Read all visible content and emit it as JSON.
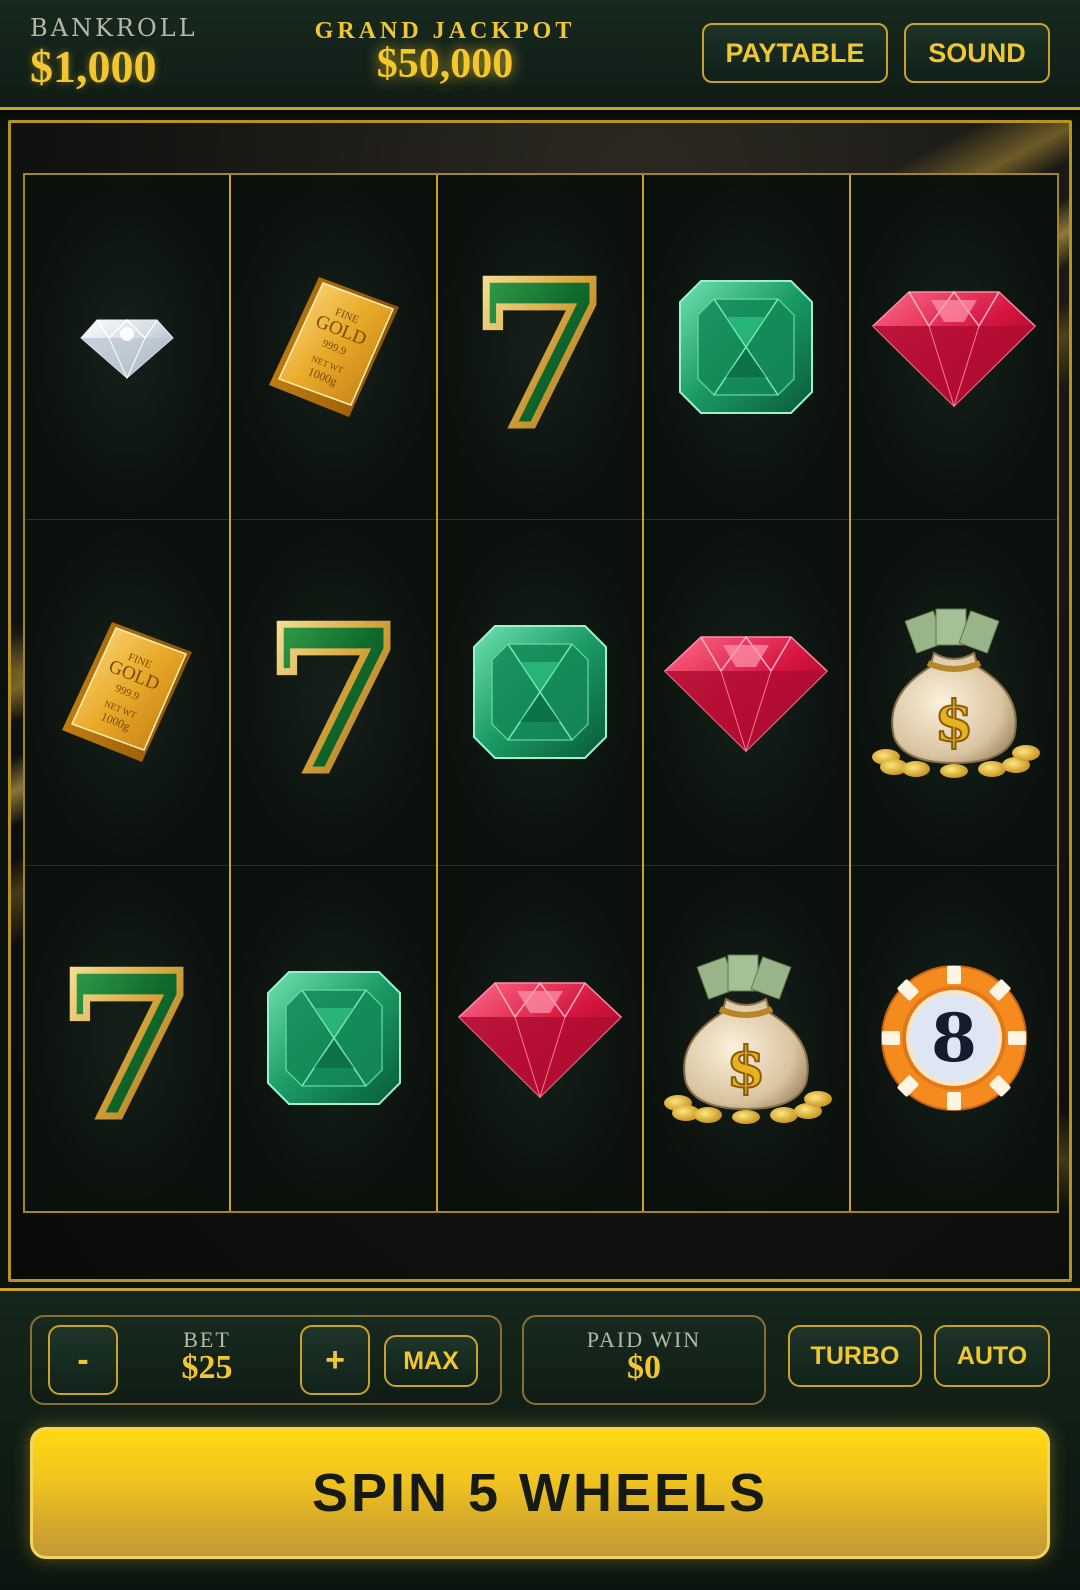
{
  "header": {
    "bankroll_label": "BANKROLL",
    "bankroll_value": "$1,000",
    "jackpot_label": "GRAND JACKPOT",
    "jackpot_value": "$50,000",
    "paytable_label": "PAYTABLE",
    "sound_label": "SOUND"
  },
  "reels": [
    [
      "diamond",
      "gold-bar",
      "seven"
    ],
    [
      "gold-bar",
      "seven",
      "emerald"
    ],
    [
      "seven",
      "emerald",
      "ruby"
    ],
    [
      "emerald",
      "ruby",
      "money-bag"
    ],
    [
      "ruby",
      "money-bag",
      "casino-chip"
    ]
  ],
  "symbol_text": {
    "gold_bar_line1": "FINE",
    "gold_bar_line2": "GOLD",
    "gold_bar_line3": "999.9",
    "gold_bar_line4": "NET WT",
    "gold_bar_line5": "1000g",
    "seven": "7",
    "dollar": "$",
    "chip_number": "8"
  },
  "controls": {
    "minus_label": "-",
    "bet_label": "BET",
    "bet_value": "$25",
    "plus_label": "+",
    "max_label": "MAX",
    "paid_win_label": "PAID WIN",
    "paid_win_value": "$0",
    "turbo_label": "TURBO",
    "auto_label": "AUTO"
  },
  "spin_label": "SPIN 5 WHEELS",
  "colors": {
    "gold": "#f0c632",
    "panel_green": "#13241b",
    "emerald": "#1fa872",
    "ruby": "#c8123a",
    "chip_orange": "#f58a1f"
  }
}
